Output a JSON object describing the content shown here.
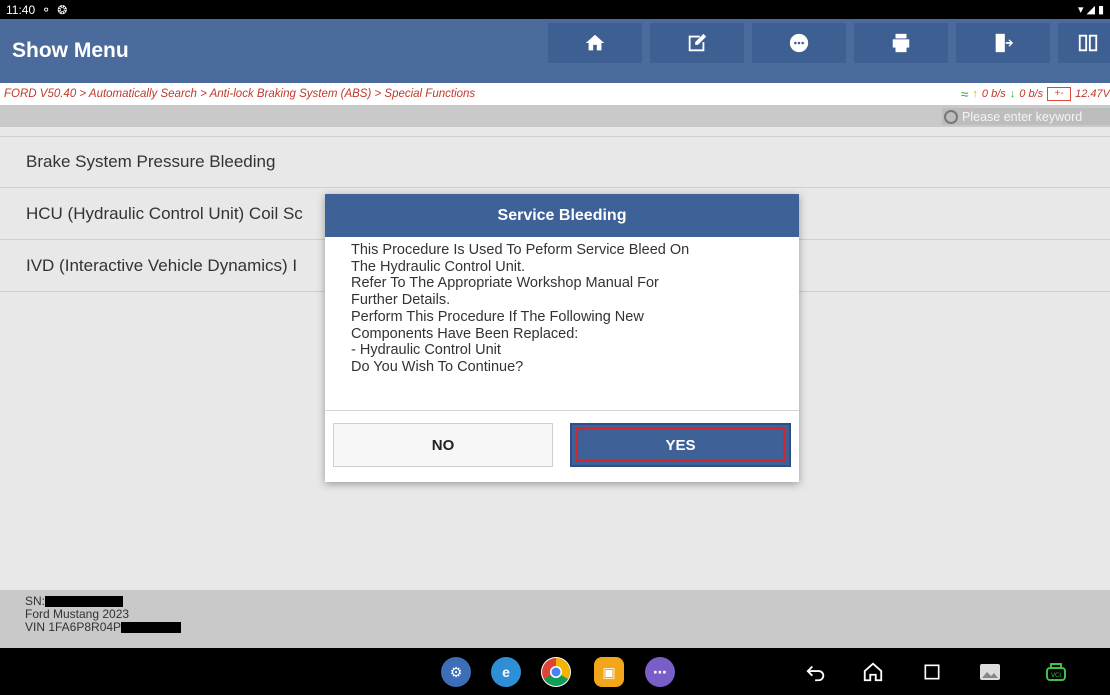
{
  "statusbar": {
    "time": "11:40"
  },
  "header": {
    "title": "Show Menu",
    "tools": [
      "home-icon",
      "edit-icon",
      "chat-icon",
      "print-icon",
      "exit-icon",
      "split-view-icon"
    ]
  },
  "breadcrumb": {
    "text": "FORD V50.40 > Automatically Search > Anti-lock Braking System (ABS) > Special Functions",
    "upload_rate": "0 b/s",
    "download_rate": "0 b/s",
    "voltage": "12.47V",
    "battery_label": "+-"
  },
  "search": {
    "placeholder": "Please enter keyword"
  },
  "list": {
    "items": [
      {
        "label": "Brake System Pressure Bleeding"
      },
      {
        "label": "HCU (Hydraulic Control Unit) Coil Sc"
      },
      {
        "label": "IVD (Interactive Vehicle Dynamics) I"
      }
    ]
  },
  "footer": {
    "sn_label": "SN:",
    "vehicle": "Ford Mustang 2023",
    "vin_label": "VIN 1FA6P8R04P"
  },
  "dialog": {
    "title": "Service Bleeding",
    "lines": [
      "This Procedure Is Used To Peform Service Bleed On",
      "The Hydraulic Control Unit.",
      "Refer To The Appropriate Workshop Manual For",
      "Further Details.",
      "Perform This Procedure If The Following New",
      "Components Have Been Replaced:",
      "- Hydraulic Control Unit",
      "Do You Wish To Continue?"
    ],
    "no_label": "NO",
    "yes_label": "YES"
  },
  "navbar": {
    "apps": [
      "settings-app-icon",
      "browser-app-icon",
      "chrome-app-icon",
      "files-app-icon",
      "app-drawer-icon"
    ],
    "system": [
      "back-icon",
      "home-icon",
      "recents-icon",
      "gallery-icon",
      "vci-icon"
    ]
  },
  "colors": {
    "header_bg": "#4a6b9c",
    "accent": "#3e6198",
    "breadcrumb_text": "#c0392b",
    "highlight_border": "#d0262f"
  }
}
